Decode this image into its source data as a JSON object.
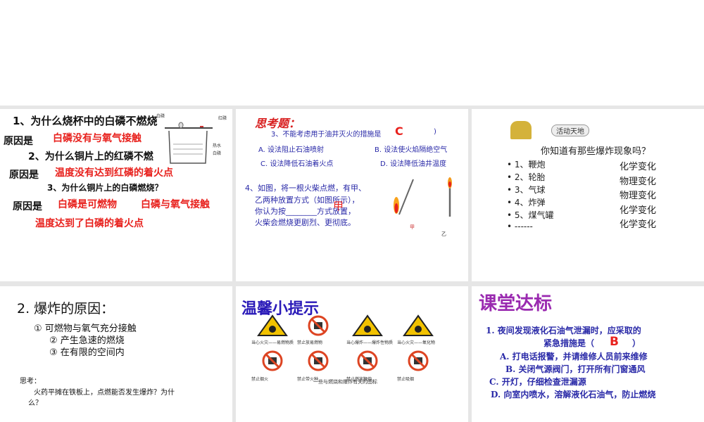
{
  "slide1": {
    "q1": "1、为什么烧杯中的白磷不燃烧",
    "reason_label": "原因是",
    "a1": "白磷没有与氧气接触",
    "q2": "2、为什么铜片上的红磷不燃",
    "a2": "温度没有达到红磷的着火点",
    "q3": "3、为什么铜片上的白磷燃烧？",
    "a3a": "白磷是可燃物",
    "a3b": "白磷与氧气接触",
    "a3c": "温度达到了白磷的着火点",
    "diagram": {
      "white_p_top": "白磷",
      "red_p": "红磷",
      "hot_water": "热水",
      "white_p_bottom": "白磷"
    }
  },
  "slide2": {
    "title": "思考题：",
    "q3": "3、不能考虑用于油井灭火的措施是",
    "answer": "C",
    "close_paren": ")",
    "opt_a": "A. 设法阻止石油喷射",
    "opt_b": "B. 设法使火焰隔绝空气",
    "opt_c": "C. 设法降低石油着火点",
    "opt_d": "D. 设法降低油井温度",
    "q4_lines": [
      "4、如图，将一根火柴点燃，有甲、",
      "乙两种放置方式（如图所示），",
      "你认为按________方式放置，",
      "火柴会燃烧更剧烈、更彻底。"
    ],
    "q4_answer": "甲",
    "label_jia": "甲",
    "label_yi": "乙"
  },
  "slide3": {
    "banner": "活动天地",
    "question": "你知道有那些爆炸现象吗？",
    "items": [
      {
        "label": "1、鞭炮",
        "type": "化学变化"
      },
      {
        "label": "2、轮胎",
        "type": "物理变化"
      },
      {
        "label": "3、气球",
        "type": "物理变化"
      },
      {
        "label": "4、炸弹",
        "type": "化学变化"
      },
      {
        "label": "5、煤气罐",
        "type": "化学变化"
      },
      {
        "label": "------"
      }
    ]
  },
  "slide4": {
    "title": "2. 爆炸的原因：",
    "points": [
      "① 可燃物与氧气充分接触",
      "② 产生急速的燃烧",
      "③ 在有限的空间内"
    ],
    "think_label": "思考：",
    "think_lines": [
      "火药平摊在铁板上，点燃能否发生爆炸？为什",
      "么？"
    ]
  },
  "slide5": {
    "title": "温馨小提示",
    "signs": [
      "当心火灾——易燃物质",
      "禁止放易燃物",
      "当心爆炸——爆炸性物质",
      "当心火灾——氧化物",
      "禁止烟火",
      "禁止带火种",
      "禁止燃放鞭炮",
      "禁止吸烟"
    ],
    "caption": "一些与燃烧和爆炸有关的图标"
  },
  "slide6": {
    "title": "课堂达标",
    "q_line1": "1. 夜间发现液化石油气泄漏时，应采取的",
    "q_line2": "紧急措施是（",
    "answer": "B",
    "close": "）",
    "opt_a": "A. 打电话报警，并请维修人员前来维修",
    "opt_b": "B. 关闭气源阀门，打开所有门窗通风",
    "opt_c": "C. 开灯，仔细检查泄漏源",
    "opt_d": "D. 向室内喷水，溶解液化石油气，防止燃烧"
  }
}
